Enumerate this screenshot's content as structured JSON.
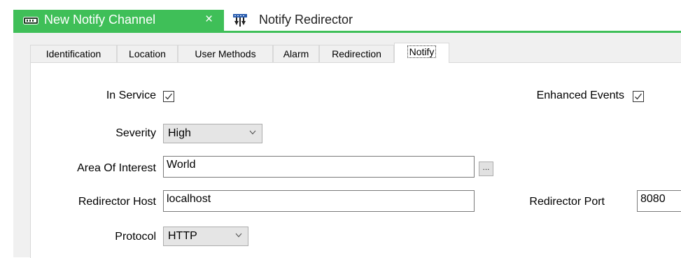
{
  "document_tabs": [
    {
      "title": "New Notify Channel",
      "close_glyph": "×",
      "icon": "channel-icon",
      "active": true
    },
    {
      "title": "Notify Redirector",
      "icon": "network-icon",
      "active": false
    }
  ],
  "colors": {
    "accent": "#3fbf58"
  },
  "property_tabs": [
    {
      "label": "Identification"
    },
    {
      "label": "Location"
    },
    {
      "label": "User Methods"
    },
    {
      "label": "Alarm"
    },
    {
      "label": "Redirection"
    },
    {
      "label": "Notify",
      "active": true
    }
  ],
  "form": {
    "in_service": {
      "label": "In Service",
      "checked": true
    },
    "enhanced_events": {
      "label": "Enhanced Events",
      "checked": true
    },
    "severity": {
      "label": "Severity",
      "value": "High"
    },
    "area_of_interest": {
      "label": "Area Of Interest",
      "value": "World",
      "browse_label": "..."
    },
    "redirector_host": {
      "label": "Redirector Host",
      "value": "localhost"
    },
    "redirector_port": {
      "label": "Redirector Port",
      "value": "8080"
    },
    "protocol": {
      "label": "Protocol",
      "value": "HTTP"
    }
  }
}
